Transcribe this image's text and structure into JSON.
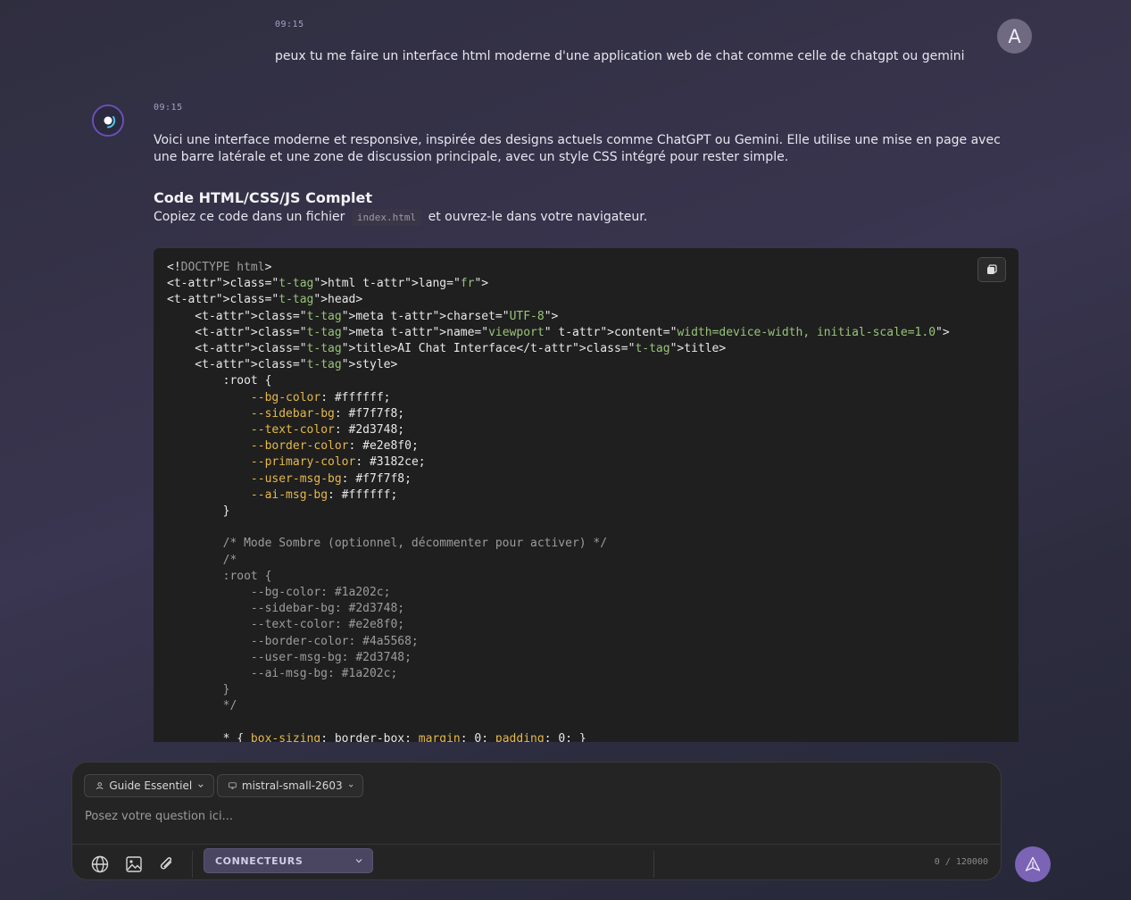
{
  "user_message": {
    "time": "09:15",
    "avatar_letter": "A",
    "text": "peux tu me faire un interface html moderne d'une application web de chat comme celle de chatgpt ou gemini"
  },
  "ai_message": {
    "time": "09:15",
    "intro": "Voici une interface moderne et responsive, inspirée des designs actuels comme ChatGPT ou Gemini. Elle utilise une mise en page avec une barre latérale et une zone de discussion principale, avec un style CSS intégré pour rester simple.",
    "heading": "Code HTML/CSS/JS Complet",
    "sub_before": "Copiez ce code dans un fichier",
    "sub_code": "index.html",
    "sub_after": "et ouvrez-le dans votre navigateur.",
    "code_lines": [
      "<!DOCTYPE html>",
      "<html lang=\"fr\">",
      "<head>",
      "    <meta charset=\"UTF-8\">",
      "    <meta name=\"viewport\" content=\"width=device-width, initial-scale=1.0\">",
      "    <title>AI Chat Interface</title>",
      "    <style>",
      "        :root {",
      "            --bg-color: #ffffff;",
      "            --sidebar-bg: #f7f7f8;",
      "            --text-color: #2d3748;",
      "            --border-color: #e2e8f0;",
      "            --primary-color: #3182ce;",
      "            --user-msg-bg: #f7f7f8;",
      "            --ai-msg-bg: #ffffff;",
      "        }",
      "",
      "        /* Mode Sombre (optionnel, décommenter pour activer) */",
      "        /*",
      "        :root {",
      "            --bg-color: #1a202c;",
      "            --sidebar-bg: #2d3748;",
      "            --text-color: #e2e8f0;",
      "            --border-color: #4a5568;",
      "            --user-msg-bg: #2d3748;",
      "            --ai-msg-bg: #1a202c;",
      "        }",
      "        */",
      "",
      "        * { box-sizing: border-box; margin: 0; padding: 0; }"
    ]
  },
  "composer": {
    "guide_label": "Guide Essentiel",
    "model_label": "mistral-small-2603",
    "placeholder": "Posez votre question ici...",
    "connectors_label": "CONNECTEURS",
    "counter": "0 / 120000"
  },
  "colors": {
    "accent": "#7b64b5",
    "code_bg": "#1f1f1f",
    "composer_bg": "#242424"
  }
}
